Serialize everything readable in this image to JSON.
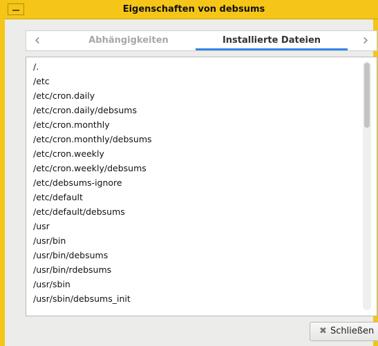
{
  "window": {
    "title": "Eigenschaften von debsums"
  },
  "tabs": [
    {
      "label": "Abhängigkeiten",
      "active": false
    },
    {
      "label": "Installierte Dateien",
      "active": true
    }
  ],
  "files": [
    "/.",
    "/etc",
    "/etc/cron.daily",
    "/etc/cron.daily/debsums",
    "/etc/cron.monthly",
    "/etc/cron.monthly/debsums",
    "/etc/cron.weekly",
    "/etc/cron.weekly/debsums",
    "/etc/debsums-ignore",
    "/etc/default",
    "/etc/default/debsums",
    "/usr",
    "/usr/bin",
    "/usr/bin/debsums",
    "/usr/bin/rdebsums",
    "/usr/sbin",
    "/usr/sbin/debsums_init"
  ],
  "buttons": {
    "close_label": "Schließen"
  },
  "icons": {
    "tab_prev": "chevron-left-icon",
    "tab_next": "chevron-right-icon",
    "close": "close-icon",
    "menu": "window-menu-icon"
  },
  "colors": {
    "titlebar": "#f5c518",
    "active_tab_underline": "#3584e4"
  }
}
